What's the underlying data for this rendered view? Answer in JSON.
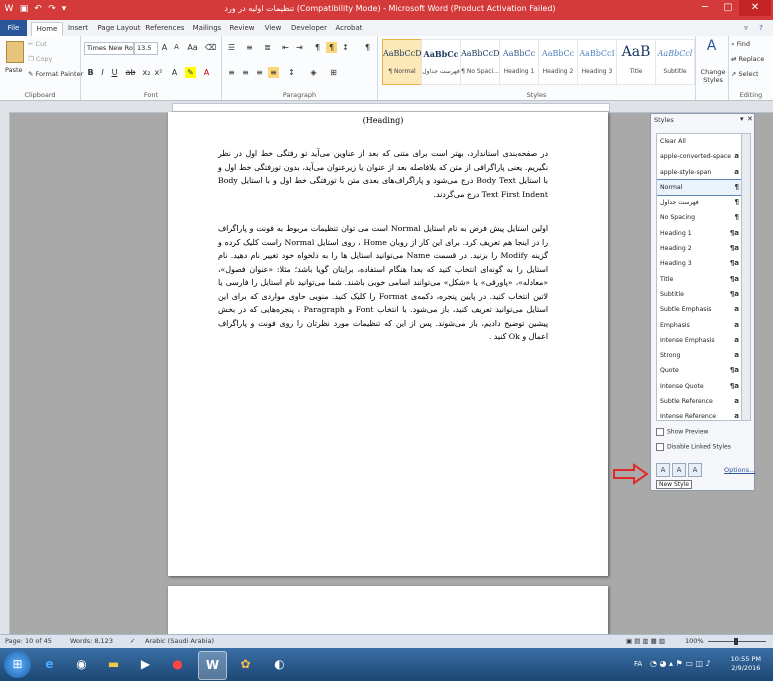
{
  "window": {
    "title": "تنظیمات اولیه در ورد (Compatibility Mode) - Microsoft Word (Product Activation Failed)",
    "minimize": "─",
    "maximize": "▢",
    "close": "✕"
  },
  "tabs": [
    "File",
    "Home",
    "Insert",
    "Page Layout",
    "References",
    "Mailings",
    "Review",
    "View",
    "Developer",
    "Acrobat"
  ],
  "clipboard": {
    "group_label": "Clipboard",
    "paste": "Paste",
    "cut": "Cut",
    "copy": "Copy",
    "format_painter": "Format Painter"
  },
  "font": {
    "group_label": "Font",
    "font_name": "Times New Rom",
    "font_size": "13.5"
  },
  "paragraph": {
    "group_label": "Paragraph"
  },
  "styles_gallery": {
    "group_label": "Styles",
    "items": [
      {
        "preview": "AaBbCcDc",
        "name": "¶ Normal"
      },
      {
        "preview": "AaBbCc",
        "name": "فهرست جداول"
      },
      {
        "preview": "AaBbCcDc",
        "name": "¶ No Spaci..."
      },
      {
        "preview": "AaBbCc",
        "name": "Heading 1"
      },
      {
        "preview": "AaBbCc",
        "name": "Heading 2"
      },
      {
        "preview": "AaBbCcI",
        "name": "Heading 3"
      },
      {
        "preview": "AaB",
        "name": "Title"
      },
      {
        "preview": "AaBbCcl",
        "name": "Subtitle"
      }
    ],
    "change_styles": "Change Styles"
  },
  "editing": {
    "group_label": "Editing",
    "find": "Find",
    "replace": "Replace",
    "select": "Select"
  },
  "document": {
    "heading_line": "(Heading) ",
    "para1": "در صفحه‌بندی استاندارد، بهتر است برای متنی که بعد از عناوین می‌آید تو رفتگی خط اول در نظر نگیریم. یعنی پاراگرافی از متن که بلافاصله بعد از عنوان یا زیرعنوان می‌آید، بدون تورفتگی خط اول و با استایل Body Text درج می‌شود و پاراگراف‌های بعدی متن با تورفتگی خط اول و با استایل Body Text First Indent درج می‌گردند.",
    "para2": "اولین استایل پیش فرض به نام استایل Normal است می توان تنظیمات مربوط به فونت و پاراگراف را در اینجا هم تعریف کرد. برای این کار از روبان Home ، روی استایل Normal راست کلیک کرده و گزینه Modify را بزنید. در قسمت Name می‌توانید استایل ها را به دلخواه خود تغییر نام دهید. نام استایل را به گونه‌ای انتخاب کنید که بعدا هنگام استفاده، برایتان گویا باشد؛ مثلا: «عنوان فصول»، «معادله»، «پاورقی» یا «شکل» می‌توانند اسامی خوبی باشند. شما می‌توانید نام استایل را فارسی یا لاتین انتخاب کنید. در پایین پنجره، دکمه‌ی Format را کلیک کنید. منویی حاوی مواردی که برای این استایل می‌توانید تعریف کنید، باز می‌شود. با انتخاب Font و Paragraph ، پنجره‌هایی که در بخش پیشین توضیح دادیم، باز می‌شوند. پس از این که تنظیمات مورد نظرتان را روی فونت و پاراگراف اعمال و Ok کنید ."
  },
  "styles_pane": {
    "title": "Styles",
    "items": [
      {
        "name": "Clear All",
        "icon": ""
      },
      {
        "name": "apple-converted-space",
        "icon": "a"
      },
      {
        "name": "apple-style-span",
        "icon": "a"
      },
      {
        "name": "Normal",
        "icon": "¶"
      },
      {
        "name": "فهرست جداول",
        "icon": "¶"
      },
      {
        "name": "No Spacing",
        "icon": "¶"
      },
      {
        "name": "Heading 1",
        "icon": "¶a"
      },
      {
        "name": "Heading 2",
        "icon": "¶a"
      },
      {
        "name": "Heading 3",
        "icon": "¶a"
      },
      {
        "name": "Title",
        "icon": "¶a"
      },
      {
        "name": "Subtitle",
        "icon": "¶a"
      },
      {
        "name": "Subtle Emphasis",
        "icon": "a"
      },
      {
        "name": "Emphasis",
        "icon": "a"
      },
      {
        "name": "Intense Emphasis",
        "icon": "a"
      },
      {
        "name": "Strong",
        "icon": "a"
      },
      {
        "name": "Quote",
        "icon": "¶a"
      },
      {
        "name": "Intense Quote",
        "icon": "¶a"
      },
      {
        "name": "Subtle Reference",
        "icon": "a"
      },
      {
        "name": "Intense Reference",
        "icon": "a"
      }
    ],
    "selected": "Normal",
    "show_preview": "Show Preview",
    "disable_linked": "Disable Linked Styles",
    "options": "Options...",
    "tooltip": "New Style"
  },
  "status": {
    "page": "Page: 10 of 45",
    "words": "Words: 8,123",
    "language": "Arabic (Saudi Arabia)",
    "zoom": "100%"
  },
  "taskbar": {
    "lang": "FA",
    "time": "10:55 PM",
    "date": "2/9/2016"
  },
  "colors": {
    "titlebar": "#d43a3a",
    "file_tab": "#2a5699",
    "arrow": "#e02a2a"
  }
}
